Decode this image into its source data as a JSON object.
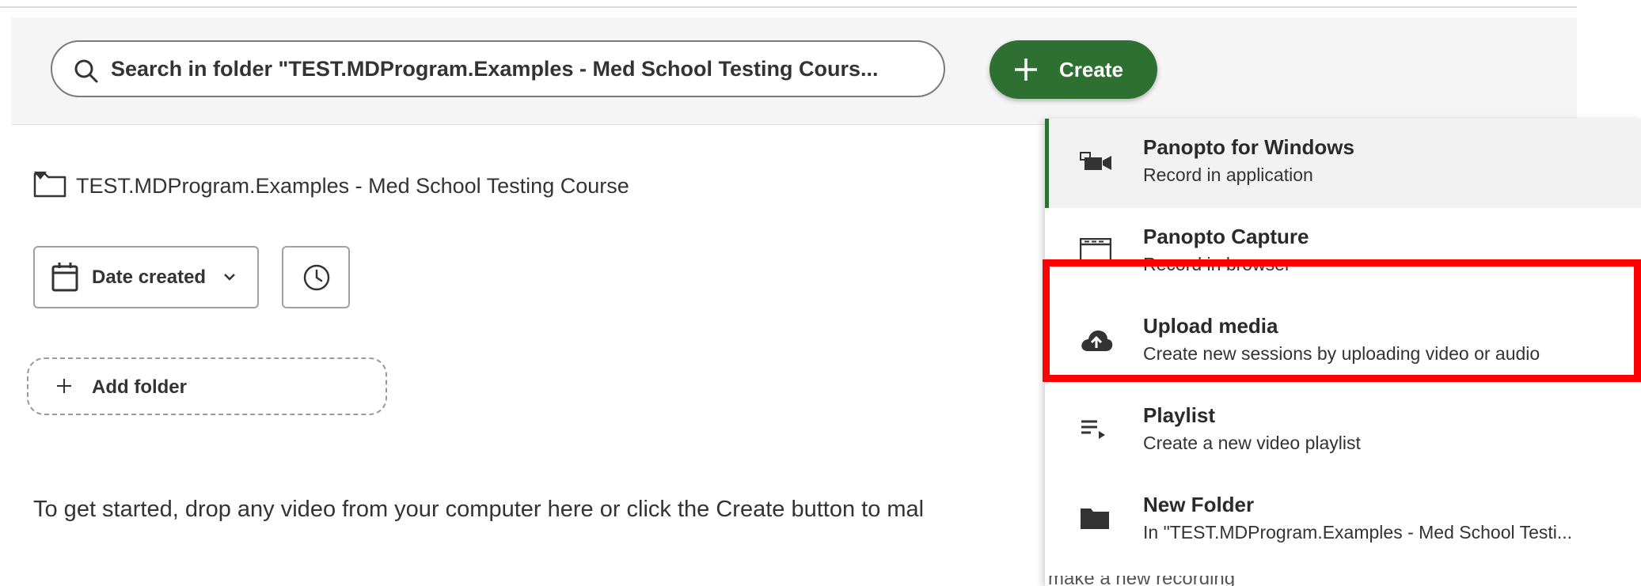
{
  "search": {
    "placeholder": "Search in folder \"TEST.MDProgram.Examples - Med School Testing Cours..."
  },
  "create_button": {
    "label": "Create"
  },
  "folder": {
    "name": "TEST.MDProgram.Examples - Med School Testing Course"
  },
  "sort": {
    "label": "Date created"
  },
  "add_folder": {
    "label": "Add folder"
  },
  "empty_message": "To get started, drop any video from your computer here or click the Create button to mal",
  "create_menu": {
    "items": [
      {
        "title": "Panopto for Windows",
        "desc": "Record in application",
        "icon": "video-camera-icon"
      },
      {
        "title": "Panopto Capture",
        "desc": "Record in browser",
        "icon": "browser-window-icon"
      },
      {
        "title": "Upload media",
        "desc": "Create new sessions by uploading video or audio",
        "icon": "cloud-upload-icon"
      },
      {
        "title": "Playlist",
        "desc": "Create a new video playlist",
        "icon": "playlist-icon"
      },
      {
        "title": "New Folder",
        "desc": "In \"TEST.MDProgram.Examples - Med School Testi...",
        "icon": "folder-icon"
      }
    ],
    "cutoff_text": "make a new recording"
  },
  "colors": {
    "accent_green": "#2e7032",
    "highlight_red": "#ff0000"
  }
}
